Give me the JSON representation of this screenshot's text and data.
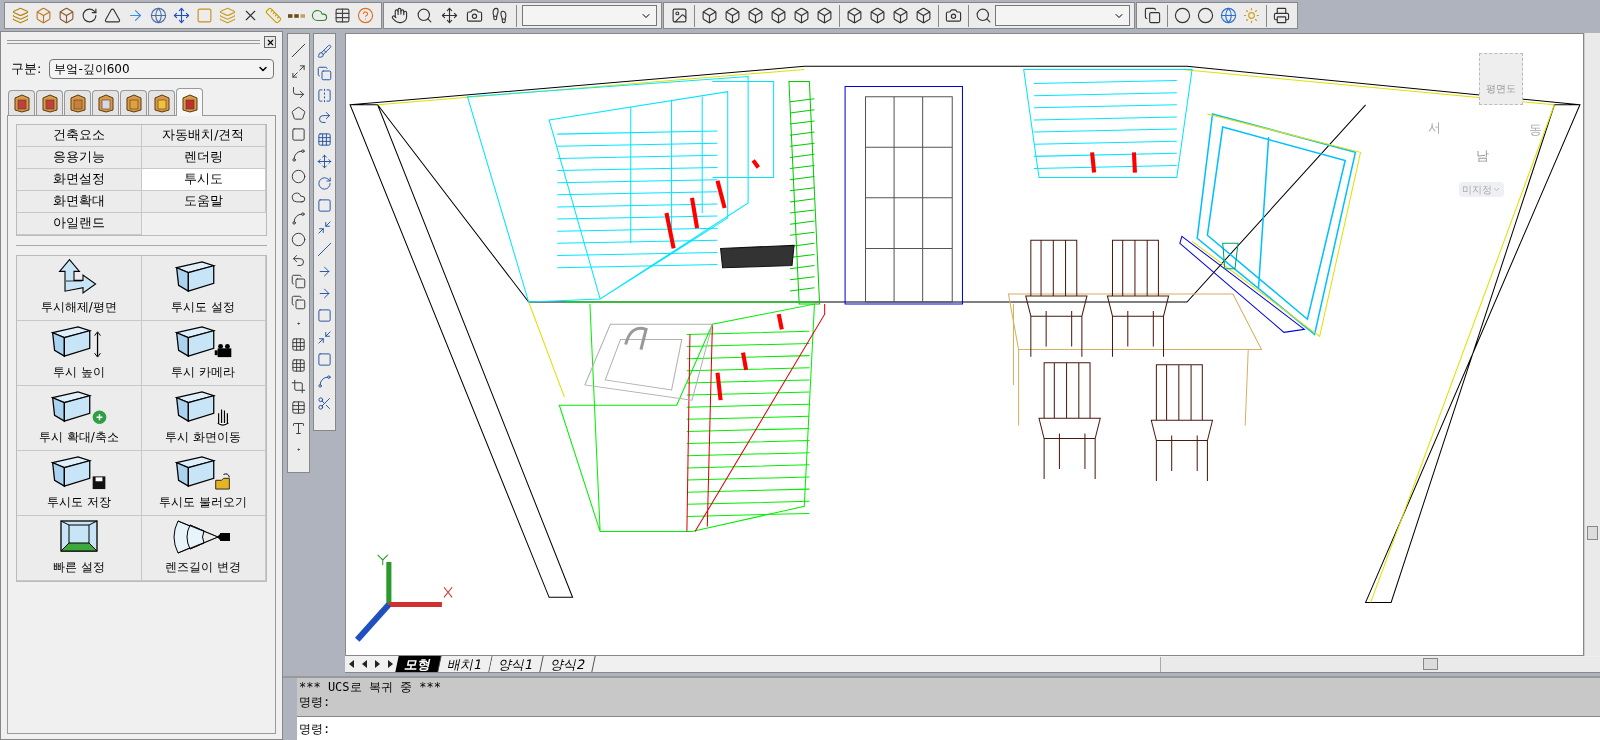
{
  "panel": {
    "field_label": "구분:",
    "dropdown_value": "부엌-깊이600",
    "category_tabs": [
      {
        "selected": false
      },
      {
        "selected": false
      },
      {
        "selected": false
      },
      {
        "selected": false
      },
      {
        "selected": false
      },
      {
        "selected": false
      },
      {
        "selected": true
      }
    ],
    "menu": [
      {
        "label": "건축요소",
        "selected": false
      },
      {
        "label": "자동배치/견적",
        "selected": false
      },
      {
        "label": "응용기능",
        "selected": false
      },
      {
        "label": "렌더링",
        "selected": false
      },
      {
        "label": "화면설정",
        "selected": false
      },
      {
        "label": "투시도",
        "selected": true
      },
      {
        "label": "화면확대",
        "selected": false
      },
      {
        "label": "도움말",
        "selected": false
      },
      {
        "label": "아일랜드",
        "selected": false
      }
    ],
    "tools": [
      {
        "label": "투시해제/평면",
        "kind": "axes"
      },
      {
        "label": "투시도 설정",
        "kind": "box"
      },
      {
        "label": "투시 높이",
        "kind": "height"
      },
      {
        "label": "투시 카메라",
        "kind": "camera"
      },
      {
        "label": "투시 확대/축소",
        "kind": "zoom"
      },
      {
        "label": "투시 화면이동",
        "kind": "pan"
      },
      {
        "label": "투시도 저장",
        "kind": "save"
      },
      {
        "label": "투시도 불러오기",
        "kind": "open"
      },
      {
        "label": "빠른 설정",
        "kind": "room"
      },
      {
        "label": "렌즈길이 변경",
        "kind": "lens"
      }
    ]
  },
  "viewcube": {
    "face": "평면도",
    "west": "서",
    "east": "동",
    "south": "남",
    "ucs_menu": "미지정"
  },
  "layout_tabs": [
    {
      "label": "모형",
      "selected": true
    },
    {
      "label": "배치1",
      "selected": false
    },
    {
      "label": "양식1",
      "selected": false
    },
    {
      "label": "양식2",
      "selected": false
    }
  ],
  "command": {
    "history": [
      "*** UCS로 복귀 중 ***",
      "명령:"
    ],
    "prompt": "명령:"
  }
}
